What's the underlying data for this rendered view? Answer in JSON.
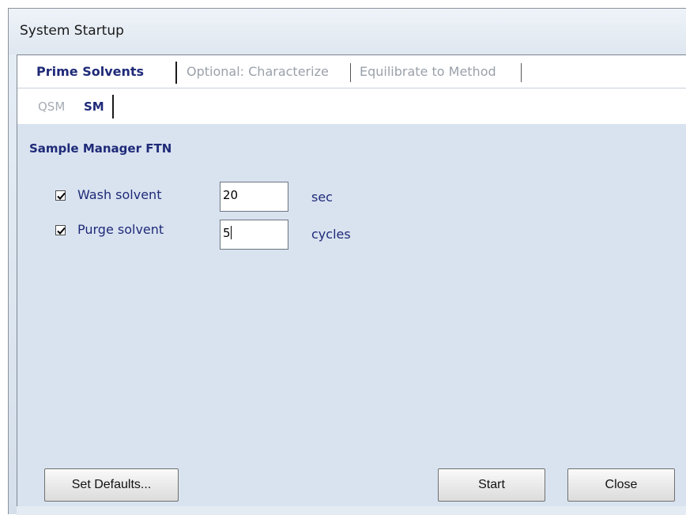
{
  "window": {
    "title": "System Startup"
  },
  "main_tabs": [
    {
      "label": "Prime Solvents",
      "active": true
    },
    {
      "label": "Optional: Characterize",
      "active": false
    },
    {
      "label": "Equilibrate to Method",
      "active": false
    }
  ],
  "sub_tabs": [
    {
      "label": "QSM",
      "active": false
    },
    {
      "label": "SM",
      "active": true
    }
  ],
  "section": {
    "title": "Sample Manager FTN"
  },
  "fields": [
    {
      "label": "Wash solvent",
      "checked": true,
      "value": "20",
      "unit": "sec"
    },
    {
      "label": "Purge solvent",
      "checked": true,
      "value": "5",
      "unit": "cycles"
    }
  ],
  "buttons": {
    "set_defaults": "Set Defaults...",
    "start": "Start",
    "close": "Close"
  }
}
